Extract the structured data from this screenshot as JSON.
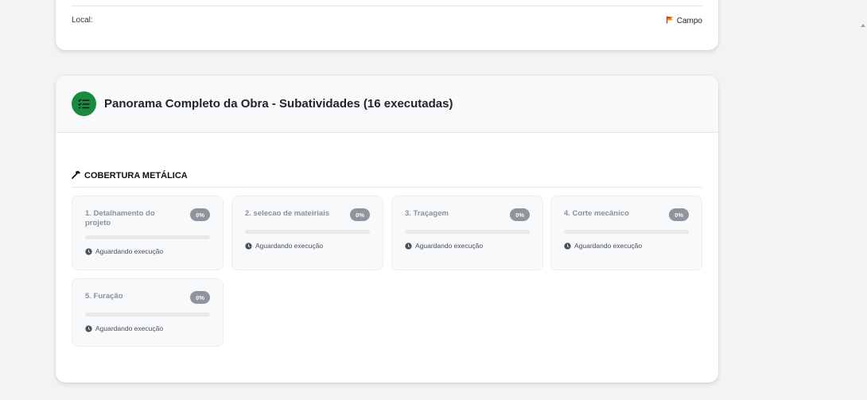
{
  "top_card": {
    "local_label": "Local:",
    "campo_label": "Campo",
    "campo_icon": "flag-icon"
  },
  "panorama": {
    "title": "Panorama Completo da Obra - Subatividades (16 executadas)",
    "header_icon": "checklist-icon",
    "header_icon_color": "#198a3f",
    "section": {
      "title": "COBERTURA METÁLICA",
      "icon": "hammer-icon",
      "subactivities": [
        {
          "name": "1. Detalhamento do projeto",
          "percent_label": "0%",
          "progress": 0,
          "status": "Aguardando execução"
        },
        {
          "name": "2. selecao de mateiriais",
          "percent_label": "0%",
          "progress": 0,
          "status": "Aguardando execução"
        },
        {
          "name": "3. Traçagem",
          "percent_label": "0%",
          "progress": 0,
          "status": "Aguardando execução"
        },
        {
          "name": "4. Corte mecânico",
          "percent_label": "0%",
          "progress": 0,
          "status": "Aguardando execução"
        },
        {
          "name": "5. Furação",
          "percent_label": "0%",
          "progress": 0,
          "status": "Aguardando execução"
        }
      ]
    }
  }
}
